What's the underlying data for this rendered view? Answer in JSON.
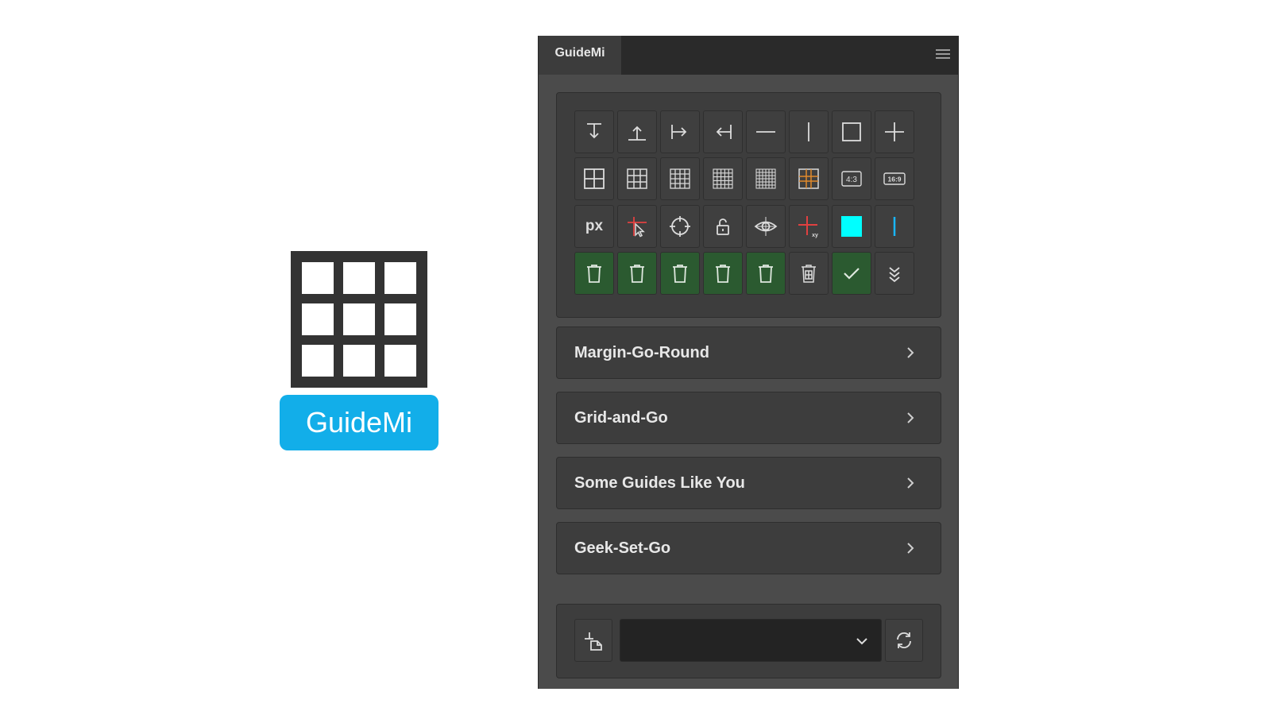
{
  "logo": {
    "text": "GuideMi",
    "grid_color": "#333333",
    "badge_color": "#12aee9"
  },
  "panel": {
    "tab_title": "GuideMi",
    "menu_icon": "hamburger-menu-icon",
    "toolbar": {
      "rows": [
        [
          "guide-top-icon",
          "guide-bottom-icon",
          "guide-left-icon",
          "guide-right-icon",
          "horizontal-center-guide-icon",
          "vertical-center-guide-icon",
          "guide-box-icon",
          "center-cross-guide-icon"
        ],
        [
          "grid-2x2-icon",
          "grid-3x3-icon",
          "grid-4x4-icon",
          "grid-5x5-icon",
          "grid-6x6-icon",
          "golden-grid-icon",
          "ratio-4-3-icon",
          "ratio-16-9-icon"
        ],
        [
          "units-px-button",
          "select-guide-icon",
          "target-crosshair-icon",
          "lock-guides-icon",
          "toggle-visibility-icon",
          "add-guide-xy-icon",
          "guide-color-swatch",
          "guide-line-style-icon"
        ],
        [
          "delete-top-guides-icon",
          "delete-bottom-guides-icon",
          "delete-left-guides-icon",
          "delete-right-guides-icon",
          "delete-center-guides-icon",
          "delete-all-guides-icon",
          "apply-check-icon",
          "expand-more-icon"
        ]
      ],
      "ratio_4_3": "4:3",
      "ratio_16_9": "16:9",
      "units_label": "px",
      "xy_label": "xy",
      "swatch_color": "#00ffff",
      "accent_cyan": "#19b6ff",
      "active_green": "#2b5a30"
    },
    "sections": [
      {
        "label": "Margin-Go-Round"
      },
      {
        "label": "Grid-and-Go"
      },
      {
        "label": "Some Guides Like You"
      },
      {
        "label": "Geek-Set-Go"
      }
    ],
    "footer": {
      "left_icon": "add-guide-from-document-icon",
      "dropdown_value": "",
      "right_icon": "refresh-icon"
    }
  }
}
